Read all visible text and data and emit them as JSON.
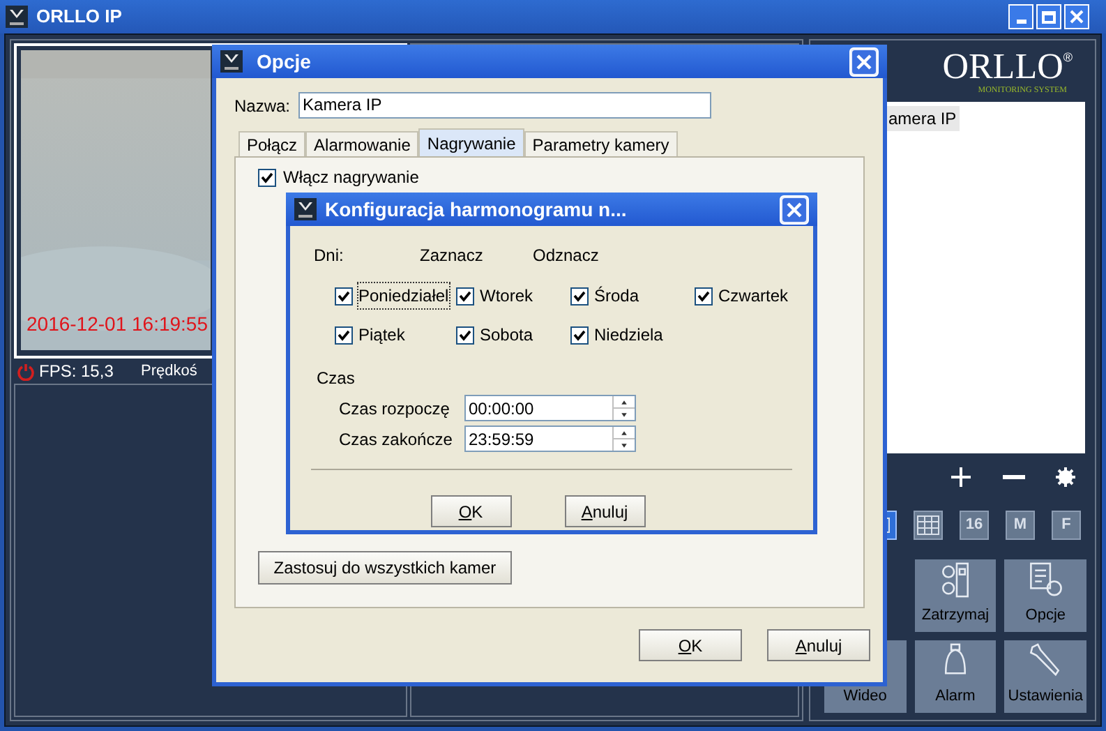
{
  "window": {
    "title": "ORLLO IP"
  },
  "camera_view": {
    "timestamp": "2016-12-01 16:19:55",
    "fps": "FPS: 15,3",
    "speed": "Prędkoś"
  },
  "sidebar": {
    "logo": "ORLLO",
    "logo_mark": "®",
    "tagline": "MONITORING SYSTEM",
    "cameras": [
      {
        "name": "amera IP",
        "selected": true
      }
    ],
    "controls": [
      {
        "kind": "plus"
      },
      {
        "kind": "minus"
      },
      {
        "kind": "gear"
      }
    ],
    "layouts": [
      {
        "kind": "single",
        "selected": true
      },
      {
        "kind": "grid",
        "selected": false
      },
      {
        "kind": "text",
        "label": "16",
        "selected": false
      },
      {
        "kind": "text",
        "label": "M",
        "selected": false
      },
      {
        "kind": "text",
        "label": "F",
        "selected": false
      }
    ],
    "tiles": [
      {
        "kind": "hidden"
      },
      {
        "kind": "stop",
        "label": "Zatrzymaj"
      },
      {
        "kind": "options",
        "label": "Opcje"
      },
      {
        "kind": "video",
        "label": "Wideo"
      },
      {
        "kind": "alarm",
        "label": "Alarm"
      },
      {
        "kind": "settings",
        "label": "Ustawienia"
      }
    ]
  },
  "options_dialog": {
    "title": "Opcje",
    "name_label": "Nazwa:",
    "name_value": "Kamera IP",
    "tabs": [
      {
        "label": "Połącz",
        "selected": false
      },
      {
        "label": "Alarmowanie",
        "selected": false
      },
      {
        "label": "Nagrywanie",
        "selected": true
      },
      {
        "label": "Parametry kamery",
        "selected": false
      }
    ],
    "record": {
      "label": "Włącz nagrywanie",
      "checked": true
    },
    "apply_all_button": "Zastosuj do wszystkich kamer",
    "buttons": [
      "OK",
      "Anuluj"
    ]
  },
  "schedule_dialog": {
    "title": "Konfiguracja harmonogramu n...",
    "days_label": "Dni:",
    "select_all": "Zaznacz",
    "deselect_all": "Odznacz",
    "days": [
      {
        "label": "Poniedziałel",
        "checked": true,
        "focused": true
      },
      {
        "label": "Wtorek",
        "checked": true,
        "focused": false
      },
      {
        "label": "Środa",
        "checked": true,
        "focused": false
      },
      {
        "label": "Czwartek",
        "checked": true,
        "focused": false
      },
      {
        "label": "Piątek",
        "checked": true,
        "focused": false
      },
      {
        "label": "Sobota",
        "checked": true,
        "focused": false
      },
      {
        "label": "Niedziela",
        "checked": true,
        "focused": false
      }
    ],
    "time_group": "Czas",
    "times": [
      {
        "label": "Czas rozpoczę",
        "value": "00:00:00"
      },
      {
        "label": "Czas zakończe",
        "value": "23:59:59"
      }
    ],
    "buttons": [
      "OK",
      "Anuluj"
    ]
  }
}
